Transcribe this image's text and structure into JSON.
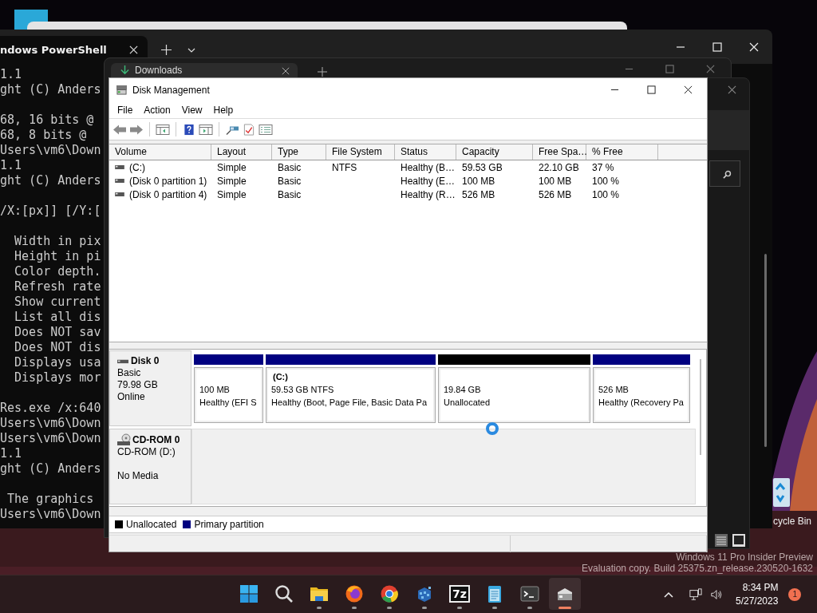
{
  "terminal": {
    "tab": {
      "title": "ndows PowerShell"
    },
    "blocks": [
      {
        "lines": [
          "1.1",
          "ght (C) Anders"
        ]
      },
      {
        "lines": [
          "68, 16 bits @",
          "68, 8 bits @",
          "Users\\vm6\\Down",
          "1.1",
          "ght (C) Anders"
        ]
      },
      {
        "lines": [
          "/X:[px]] [/Y:["
        ]
      },
      {
        "lines": [
          "  Width in pix",
          "  Height in pi",
          "  Color depth.",
          "  Refresh rate",
          "  Show current",
          "  List all dis",
          "  Does NOT sav",
          "  Does NOT dis",
          "  Displays usa",
          "  Displays mor"
        ]
      },
      {
        "lines": [
          "Res.exe /x:640",
          "Users\\vm6\\Down",
          "Users\\vm6\\Down",
          "1.1",
          "ght (C) Anders"
        ]
      },
      {
        "lines": [
          " The graphics",
          "Users\\vm6\\Down"
        ]
      }
    ]
  },
  "explorer": {
    "tab": {
      "title": "Downloads"
    }
  },
  "disk_management": {
    "window": {
      "title": "Disk Management"
    },
    "menu": [
      {
        "label": "File"
      },
      {
        "label": "Action"
      },
      {
        "label": "View"
      },
      {
        "label": "Help"
      }
    ],
    "volumes": {
      "columns": [
        "Volume",
        "Layout",
        "Type",
        "File System",
        "Status",
        "Capacity",
        "Free Spa…",
        "% Free"
      ],
      "rows": [
        {
          "volume": "(C:)",
          "layout": "Simple",
          "type": "Basic",
          "file_system": "NTFS",
          "status": "Healthy (B…",
          "capacity": "59.53 GB",
          "free_space": "22.10 GB",
          "percent_free": "37 %"
        },
        {
          "volume": "(Disk 0 partition 1)",
          "layout": "Simple",
          "type": "Basic",
          "status": "Healthy (E…",
          "capacity": "100 MB",
          "free_space": "100 MB",
          "percent_free": "100 %"
        },
        {
          "volume": "(Disk 0 partition 4)",
          "layout": "Simple",
          "type": "Basic",
          "status": "Healthy (R…",
          "capacity": "526 MB",
          "free_space": "526 MB",
          "percent_free": "100 %"
        }
      ]
    },
    "disks": [
      {
        "kind": "disk",
        "name": "Disk 0",
        "type": "Basic",
        "size": "79.98 GB",
        "status": "Online",
        "partitions": [
          {
            "kind": "primary",
            "size": "100 MB",
            "status": "Healthy (EFI S"
          },
          {
            "kind": "primary",
            "label": "(C:)",
            "size": "59.53 GB NTFS",
            "status": "Healthy (Boot, Page File, Basic Data Pa"
          },
          {
            "kind": "unallocated",
            "size": "19.84 GB",
            "status": "Unallocated"
          },
          {
            "kind": "primary",
            "size": "526 MB",
            "status": "Healthy (Recovery Pa"
          }
        ]
      },
      {
        "kind": "cdrom",
        "name": "CD-ROM 0",
        "type": "CD-ROM (D:)",
        "status": "No Media"
      }
    ],
    "legend": [
      {
        "label": "Unallocated",
        "color": "#000000"
      },
      {
        "label": "Primary partition",
        "color": "#000080"
      }
    ]
  },
  "desktop": {
    "shortcut": {
      "label": "cycle Bin"
    },
    "watermark": [
      "Windows 11 Pro Insider Preview",
      "Evaluation copy. Build 25375.zn_release.230520-1632"
    ]
  },
  "taskbar": {
    "apps": [
      {
        "kind": "start",
        "running": false,
        "selected": false
      },
      {
        "kind": "search",
        "running": false,
        "selected": false
      },
      {
        "kind": "folder",
        "running": true,
        "selected": false
      },
      {
        "kind": "firefox",
        "running": true,
        "selected": false
      },
      {
        "kind": "chrome",
        "running": true,
        "selected": false
      },
      {
        "kind": "cubes",
        "running": true,
        "selected": false
      },
      {
        "kind": "archive",
        "glyph": "7z",
        "running": true,
        "selected": false
      },
      {
        "kind": "notepad",
        "running": true,
        "selected": false
      },
      {
        "kind": "terminal",
        "running": true,
        "selected": false
      },
      {
        "kind": "disk",
        "running": true,
        "selected": true
      }
    ],
    "clock": {
      "time": "8:34 PM",
      "date": "5/27/2023"
    },
    "notifications": "1"
  }
}
